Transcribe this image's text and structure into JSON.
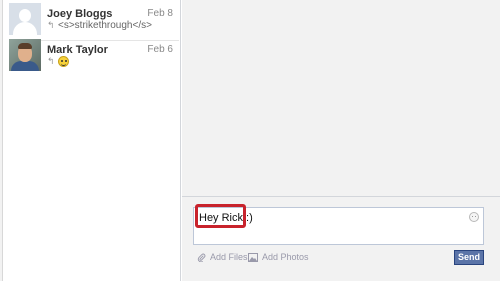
{
  "threads": [
    {
      "name": "Joey Bloggs",
      "date": "Feb 8",
      "snippet": "<s>strikethrough</s>",
      "avatar_icon": "default-profile-icon"
    },
    {
      "name": "Mark Taylor",
      "date": "Feb 6",
      "snippet": "",
      "avatar_icon": "profile-photo"
    }
  ],
  "composer": {
    "text": "Hey Rick :)",
    "add_files": "Add Files",
    "add_photos": "Add Photos",
    "send": "Send"
  },
  "colors": {
    "highlight": "#c8232c",
    "send_button": "#5b74a8"
  }
}
